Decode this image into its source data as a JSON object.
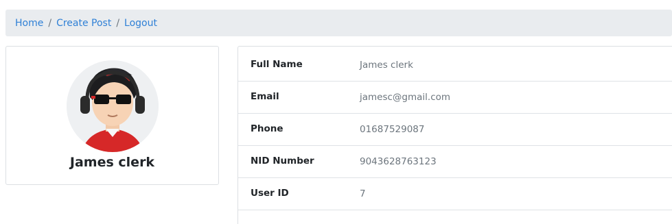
{
  "breadcrumb": {
    "items": [
      "Home",
      "Create Post",
      "Logout"
    ],
    "separator": "/"
  },
  "profile": {
    "name": "James clerk",
    "avatar_icon": "cartoon-avatar-with-sunglasses-and-headphones"
  },
  "details": [
    {
      "label": "Full Name",
      "value": "James clerk"
    },
    {
      "label": "Email",
      "value": "jamesc@gmail.com"
    },
    {
      "label": "Phone",
      "value": "01687529087"
    },
    {
      "label": "NID Number",
      "value": "9043628763123"
    },
    {
      "label": "User ID",
      "value": "7"
    }
  ],
  "colors": {
    "link": "#2f80d6",
    "breadcrumb_bg": "#e9ecef",
    "value_text": "#6c757d",
    "avatar_shirt": "#d62828"
  }
}
